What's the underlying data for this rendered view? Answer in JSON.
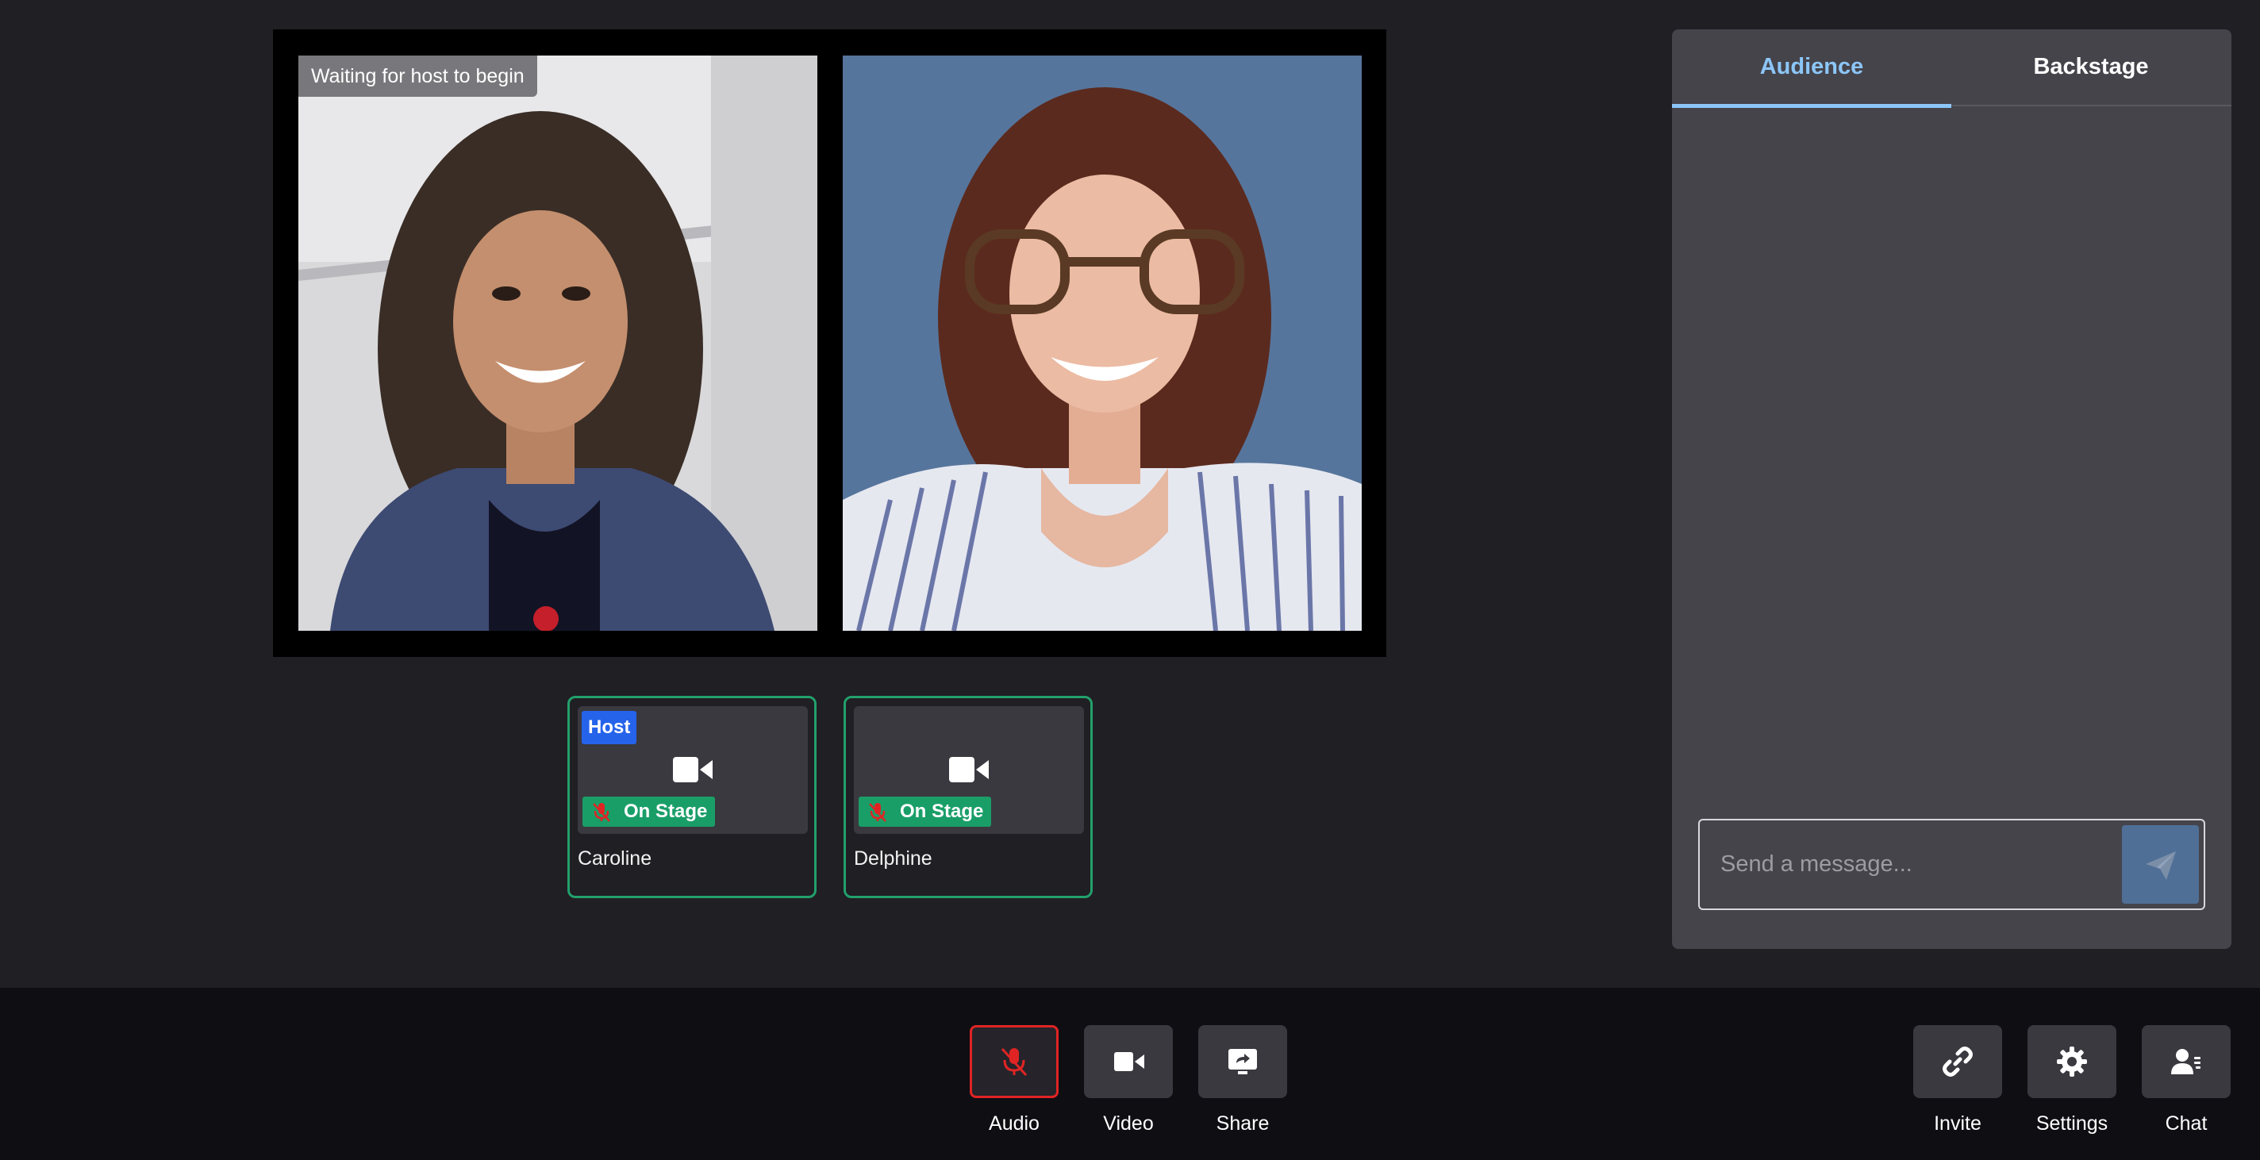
{
  "stage": {
    "status_badge": "Waiting for host to begin",
    "videos": [
      {
        "participant": "Caroline"
      },
      {
        "participant": "Delphine"
      }
    ]
  },
  "participants": [
    {
      "name": "Caroline",
      "role_badge": "Host",
      "status": "On Stage",
      "camera_icon": "video-camera-icon",
      "mic_icon": "mic-muted-icon"
    },
    {
      "name": "Delphine",
      "status": "On Stage",
      "camera_icon": "video-camera-icon",
      "mic_icon": "mic-muted-icon"
    }
  ],
  "chat": {
    "tabs": [
      {
        "label": "Audience",
        "active": true
      },
      {
        "label": "Backstage",
        "active": false
      }
    ],
    "input_placeholder": "Send a message...",
    "send_icon": "paper-plane-icon"
  },
  "toolbar": {
    "center": [
      {
        "label": "Audio",
        "icon": "mic-muted-icon",
        "state": "muted"
      },
      {
        "label": "Video",
        "icon": "video-camera-icon"
      },
      {
        "label": "Share",
        "icon": "screen-share-icon"
      }
    ],
    "right": [
      {
        "label": "Invite",
        "icon": "link-icon"
      },
      {
        "label": "Settings",
        "icon": "gear-icon"
      },
      {
        "label": "Chat",
        "icon": "people-icon"
      }
    ]
  },
  "colors": {
    "background": "#201f24",
    "panel": "#45444b",
    "accent_active_tab": "#8cc6f8",
    "on_stage_green": "#22a06b",
    "host_blue": "#2563eb",
    "muted_red": "#e02424"
  }
}
